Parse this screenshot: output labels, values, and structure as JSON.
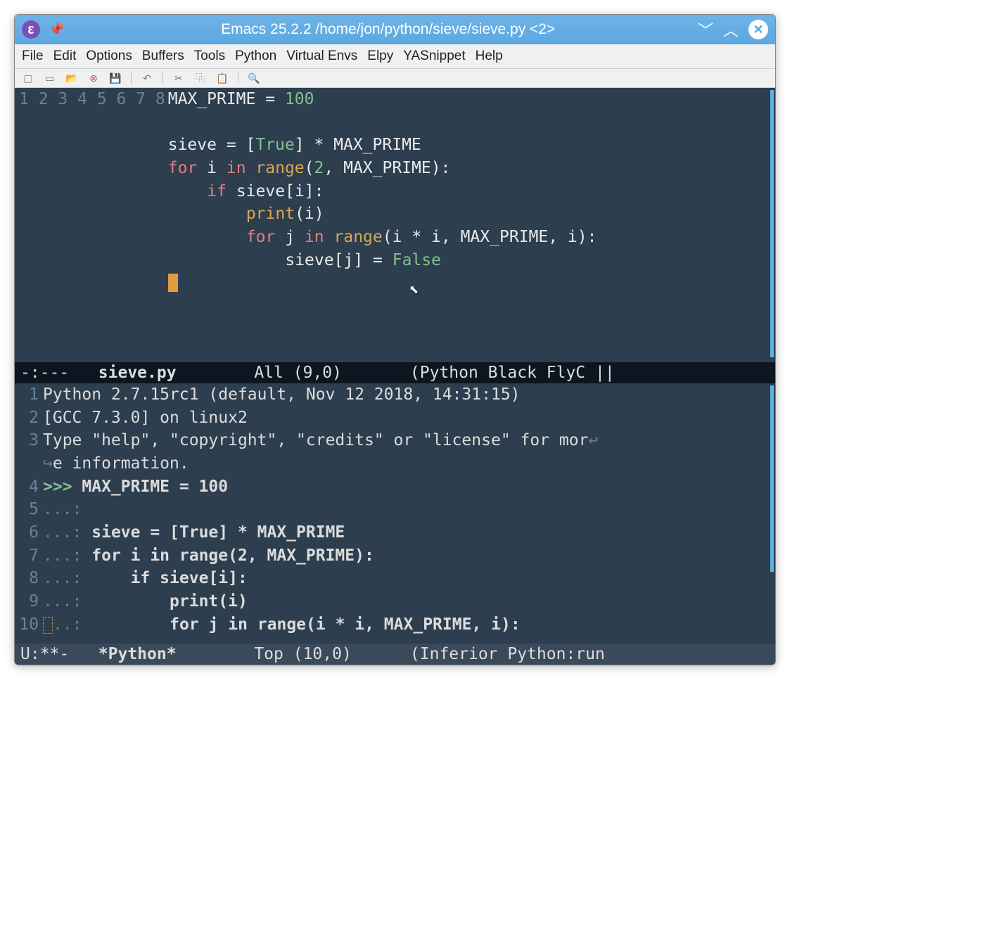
{
  "titlebar": {
    "app_icon_letter": "ε",
    "title": "Emacs 25.2.2 /home/jon/python/sieve/sieve.py <2>"
  },
  "menu": {
    "items": [
      "File",
      "Edit",
      "Options",
      "Buffers",
      "Tools",
      "Python",
      "Virtual Envs",
      "Elpy",
      "YASnippet",
      "Help"
    ]
  },
  "toolbar": {
    "icons": [
      "new-file",
      "open-dir",
      "open-file",
      "close",
      "save",
      "undo",
      "cut",
      "copy",
      "paste",
      "search"
    ]
  },
  "editor": {
    "lines": [
      {
        "n": 1,
        "tokens": [
          [
            "var",
            "MAX_PRIME"
          ],
          [
            "op",
            " = "
          ],
          [
            "const",
            "100"
          ]
        ]
      },
      {
        "n": 2,
        "tokens": []
      },
      {
        "n": 3,
        "tokens": [
          [
            "var",
            "sieve"
          ],
          [
            "op",
            " = ["
          ],
          [
            "const",
            "True"
          ],
          [
            "op",
            "] * "
          ],
          [
            "var",
            "MAX_PRIME"
          ]
        ]
      },
      {
        "n": 4,
        "tokens": [
          [
            "kw",
            "for"
          ],
          [
            "op",
            " "
          ],
          [
            "var",
            "i"
          ],
          [
            "op",
            " "
          ],
          [
            "kw",
            "in"
          ],
          [
            "op",
            " "
          ],
          [
            "builtin",
            "range"
          ],
          [
            "op",
            "("
          ],
          [
            "const",
            "2"
          ],
          [
            "op",
            ", "
          ],
          [
            "var",
            "MAX_PRIME"
          ],
          [
            "op",
            "):"
          ]
        ]
      },
      {
        "n": 5,
        "indent": 1,
        "tokens": [
          [
            "kw",
            "if"
          ],
          [
            "op",
            " "
          ],
          [
            "var",
            "sieve"
          ],
          [
            "op",
            "["
          ],
          [
            "var",
            "i"
          ],
          [
            "op",
            "]:"
          ]
        ]
      },
      {
        "n": 6,
        "indent": 2,
        "tokens": [
          [
            "builtin",
            "print"
          ],
          [
            "op",
            "("
          ],
          [
            "var",
            "i"
          ],
          [
            "op",
            ")"
          ]
        ]
      },
      {
        "n": 7,
        "indent": 2,
        "tokens": [
          [
            "kw",
            "for"
          ],
          [
            "op",
            " "
          ],
          [
            "var",
            "j"
          ],
          [
            "op",
            " "
          ],
          [
            "kw",
            "in"
          ],
          [
            "op",
            " "
          ],
          [
            "builtin",
            "range"
          ],
          [
            "op",
            "("
          ],
          [
            "var",
            "i"
          ],
          [
            "op",
            " * "
          ],
          [
            "var",
            "i"
          ],
          [
            "op",
            ", "
          ],
          [
            "var",
            "MAX_PRIME"
          ],
          [
            "op",
            ", "
          ],
          [
            "var",
            "i"
          ],
          [
            "op",
            "):"
          ]
        ]
      },
      {
        "n": 8,
        "indent": 3,
        "tokens": [
          [
            "var",
            "sieve"
          ],
          [
            "op",
            "["
          ],
          [
            "var",
            "j"
          ],
          [
            "op",
            "] = "
          ],
          [
            "const",
            "False"
          ]
        ]
      }
    ]
  },
  "modeline1": {
    "left": "-:---   ",
    "name": "sieve.py",
    "mid": "        All (9,0)       ",
    "modes": "(Python Black FlyC ||"
  },
  "repl": {
    "lines": [
      {
        "n": "1",
        "text": "Python 2.7.15rc1 (default, Nov 12 2018, 14:31:15)"
      },
      {
        "n": "2",
        "text": "[GCC 7.3.0] on linux2"
      },
      {
        "n": "3",
        "text": "Type \"help\", \"copyright\", \"credits\" or \"license\" for mor",
        "wrap": true
      },
      {
        "n": "",
        "cont_wrap": true,
        "text": "e information."
      },
      {
        "n": "4",
        "prompt": ">>> ",
        "bold": "MAX_PRIME = 100"
      },
      {
        "n": "5",
        "cont": "...: ",
        "bold": ""
      },
      {
        "n": "6",
        "cont": "...: ",
        "bold": "sieve = [True] * MAX_PRIME"
      },
      {
        "n": "7",
        "cont": "...: ",
        "bold": "for i in range(2, MAX_PRIME):"
      },
      {
        "n": "8",
        "cont": "...: ",
        "bold": "    if sieve[i]:"
      },
      {
        "n": "9",
        "cont": "...: ",
        "bold": "        print(i)"
      },
      {
        "n": "10",
        "cursor": true,
        "cont": "..: ",
        "bold": "        for j in range(i * i, MAX_PRIME, i):"
      }
    ]
  },
  "modeline2": {
    "left": "U:**-   ",
    "name": "*Python*",
    "mid": "        Top (10,0)      ",
    "modes": "(Inferior Python:run "
  }
}
